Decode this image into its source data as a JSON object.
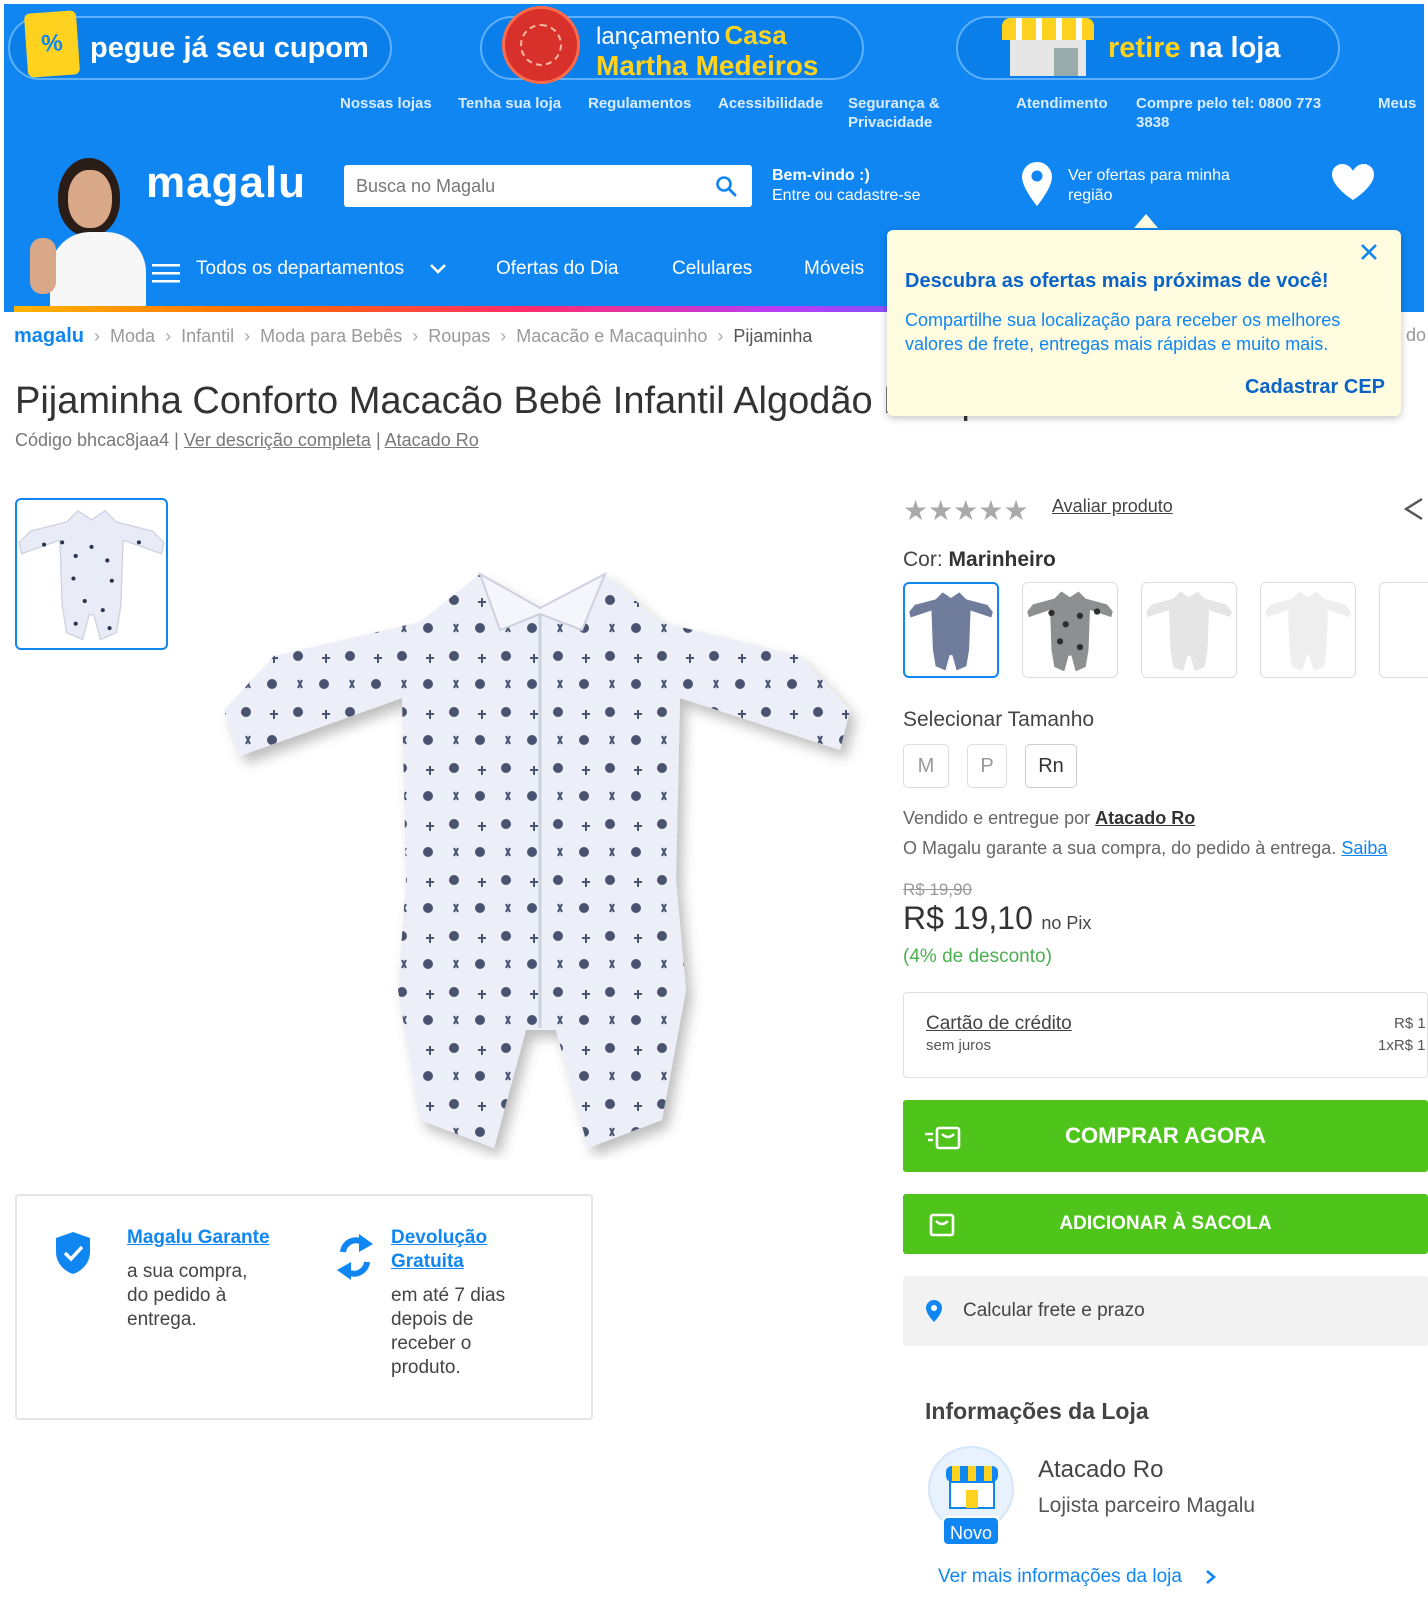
{
  "promo": {
    "coupon_label": "pegue já seu cupom",
    "coupon_icon": "percent-tag-icon",
    "launch_small": "lançamento",
    "launch_casa": "Casa",
    "launch_brand": "Martha Medeiros",
    "pickup_prefix": "retire",
    "pickup_suffix": "na loja"
  },
  "top_links": {
    "stores": "Nossas lojas",
    "own_store": "Tenha sua loja",
    "rules": "Regulamentos",
    "accessibility": "Acessibilidade",
    "security_1": "Segurança &",
    "security_2": "Privacidade",
    "support": "Atendimento",
    "phone_1": "Compre pelo tel: 0800 773",
    "phone_2": "3838",
    "mine": "Meus"
  },
  "header": {
    "logo": "magalu",
    "search_placeholder": "Busca no Magalu",
    "welcome_title": "Bem-vindo :)",
    "welcome_sub": "Entre ou cadastre-se",
    "region_1": "Ver ofertas para minha",
    "region_2": "região"
  },
  "nav": {
    "all_departments": "Todos os departamentos",
    "offers": "Ofertas do Dia",
    "phones": "Celulares",
    "furniture": "Móveis"
  },
  "tooltip": {
    "title": "Descubra as ofertas mais próximas de você!",
    "body_1": "Compartilhe sua localização para receber os melhores",
    "body_2": "valores de frete, entregas mais rápidas e muito mais.",
    "action": "Cadastrar CEP"
  },
  "breadcrumb": {
    "logo": "magalu",
    "items": [
      "Moda",
      "Infantil",
      "Moda para Bebês",
      "Roupas",
      "Macacão e Macaquinho",
      "Pijaminha"
    ],
    "overflow": "do"
  },
  "product": {
    "title": "Pijaminha Conforto Macacão Bebê Infantil Algodão Pesquinho - Atacado Ro",
    "code_label": "Código bhcac8jaa4",
    "divider": "|",
    "full_description": "Ver descrição completa",
    "seller_link": "Atacado Ro"
  },
  "rating": {
    "stars": 0,
    "max_stars": 5,
    "review_link": "Avaliar produto"
  },
  "color": {
    "label": "Cor:",
    "selected": "Marinheiro"
  },
  "size": {
    "label": "Selecionar Tamanho",
    "options": [
      "M",
      "P",
      "Rn"
    ],
    "selected": "Rn"
  },
  "seller": {
    "sold_by": "Vendido e entregue por",
    "name": "Atacado Ro",
    "guarantee": "O Magalu garante a sua compra, do pedido à entrega.",
    "know_more": "Saiba"
  },
  "price": {
    "old": "R$ 19,90",
    "current": "R$ 19,10",
    "method": "no Pix",
    "discount": "(4% de desconto)"
  },
  "payment": {
    "method": "Cartão de crédito",
    "interest": "sem juros",
    "right_1": "R$ 1",
    "right_2": "1xR$ 1"
  },
  "actions": {
    "buy_now": "COMPRAR AGORA",
    "add_to_bag": "ADICIONAR À SACOLA",
    "shipping": "Calcular frete e prazo"
  },
  "guarantees": {
    "magalu_title": "Magalu Garante",
    "magalu_text": [
      "a sua compra,",
      "do pedido à",
      "entrega."
    ],
    "return_title_1": "Devolução",
    "return_title_2": "Gratuita",
    "return_text": [
      "em até 7 dias",
      "depois de",
      "receber o",
      "produto."
    ]
  },
  "store": {
    "heading": "Informações da Loja",
    "name": "Atacado Ro",
    "subtitle": "Lojista parceiro Magalu",
    "badge": "Novo",
    "more": "Ver mais informações da loja"
  },
  "colors": {
    "brand_blue": "#0f86f2",
    "buy_green": "#4fc51b",
    "tooltip_bg": "#fffce0",
    "discount_green": "#4caf50"
  }
}
